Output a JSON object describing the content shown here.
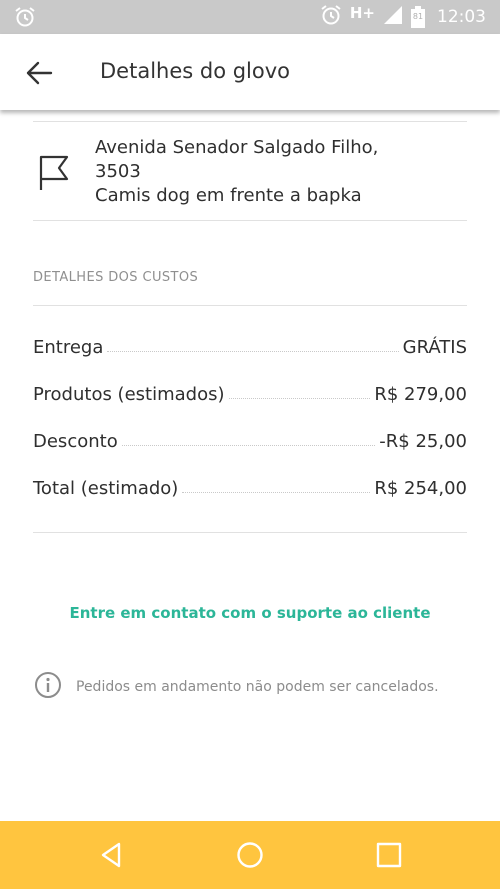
{
  "status_bar": {
    "network": "H+",
    "battery": "81",
    "time": "12:03"
  },
  "app_bar": {
    "title": "Detalhes do glovo"
  },
  "address": {
    "line1": "Avenida Senador Salgado Filho,",
    "line2": "3503",
    "line3": "Camis dog em frente a bapka"
  },
  "costs": {
    "section_label": "DETALHES DOS CUSTOS",
    "rows": [
      {
        "label": "Entrega",
        "value": "GRÁTIS"
      },
      {
        "label": "Produtos (estimados)",
        "value": "R$ 279,00"
      },
      {
        "label": "Desconto",
        "value": "-R$ 25,00"
      },
      {
        "label": "Total (estimado)",
        "value": "R$ 254,00"
      }
    ]
  },
  "support_link": "Entre em contato com o suporte ao cliente",
  "notice": "Pedidos em andamento não podem ser cancelados.",
  "colors": {
    "accent_green": "#2cb698",
    "nav_yellow": "#ffc53f",
    "status_gray": "#c9c9c9"
  }
}
